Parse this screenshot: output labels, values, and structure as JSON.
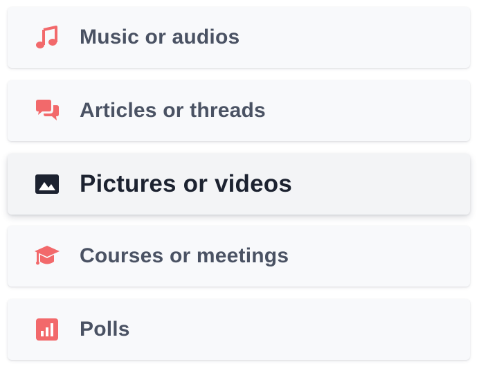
{
  "colors": {
    "accent": "#f2696b",
    "active_icon": "#1c2230",
    "label": "#4a5263",
    "active_label": "#1c2230",
    "card_bg": "#f8f9fb"
  },
  "items": [
    {
      "label": "Music or audios",
      "icon": "music-note-icon"
    },
    {
      "label": "Articles or threads",
      "icon": "chat-bubbles-icon"
    },
    {
      "label": "Pictures or videos",
      "icon": "image-icon",
      "selected": true
    },
    {
      "label": "Courses or meetings",
      "icon": "graduation-cap-icon"
    },
    {
      "label": "Polls",
      "icon": "bar-chart-icon"
    }
  ]
}
